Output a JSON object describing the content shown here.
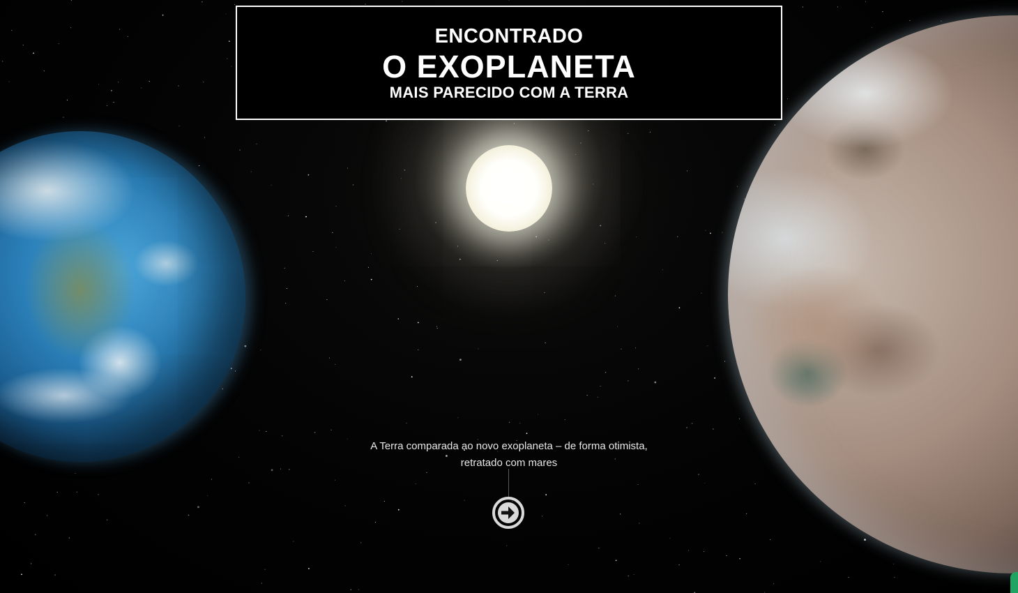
{
  "hero": {
    "title_line1": "ENCONTRADO",
    "title_line2": "O EXOPLANETA",
    "title_line3": "MAIS PARECIDO COM A TERRA"
  },
  "caption": {
    "line1": "A Terra comparada ao novo exoplaneta – de forma otimista,",
    "line2": "retratado com mares"
  },
  "navigation": {
    "next_icon": "arrow-right-circle-icon"
  },
  "colors": {
    "background": "#000000",
    "title_border": "#ffffff",
    "text": "#ffffff",
    "corner_accent": "#1fa463"
  }
}
